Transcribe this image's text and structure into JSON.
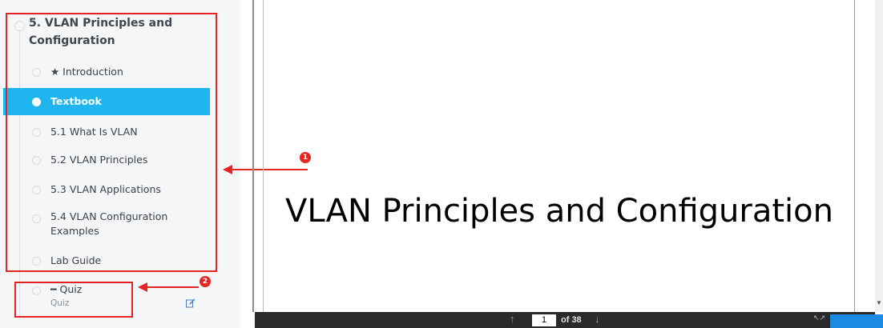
{
  "sidebar": {
    "chapter_title": "5. VLAN Principles and Configuration",
    "items": [
      {
        "label": "★ Introduction",
        "active": false
      },
      {
        "label": "Textbook",
        "active": true
      },
      {
        "label": "5.1 What Is VLAN",
        "active": false
      },
      {
        "label": "5.2 VLAN Principles",
        "active": false
      },
      {
        "label": "5.3 VLAN Applications",
        "active": false
      },
      {
        "label": "5.4 VLAN Configuration Examples",
        "active": false
      },
      {
        "label": "Lab Guide",
        "active": false
      }
    ],
    "quiz": {
      "label": "━ Quiz",
      "sublabel": "Quiz",
      "icon": "edit-icon"
    }
  },
  "annotations": {
    "badge_1": "1",
    "badge_2": "2",
    "color": "#e52521"
  },
  "viewer": {
    "slide_title": "VLAN Principles and Configuration",
    "current_page": "1",
    "page_total_text": "of 38",
    "prev_icon": "arrow-up-icon",
    "next_icon": "arrow-down-icon",
    "fullscreen_icon": "expand-icon"
  },
  "colors": {
    "active_item": "#1fb6f0",
    "sidebar_bg": "#f5f6f7",
    "toolbar_bg": "#2b2b2b",
    "action_button": "#1a8be0"
  }
}
